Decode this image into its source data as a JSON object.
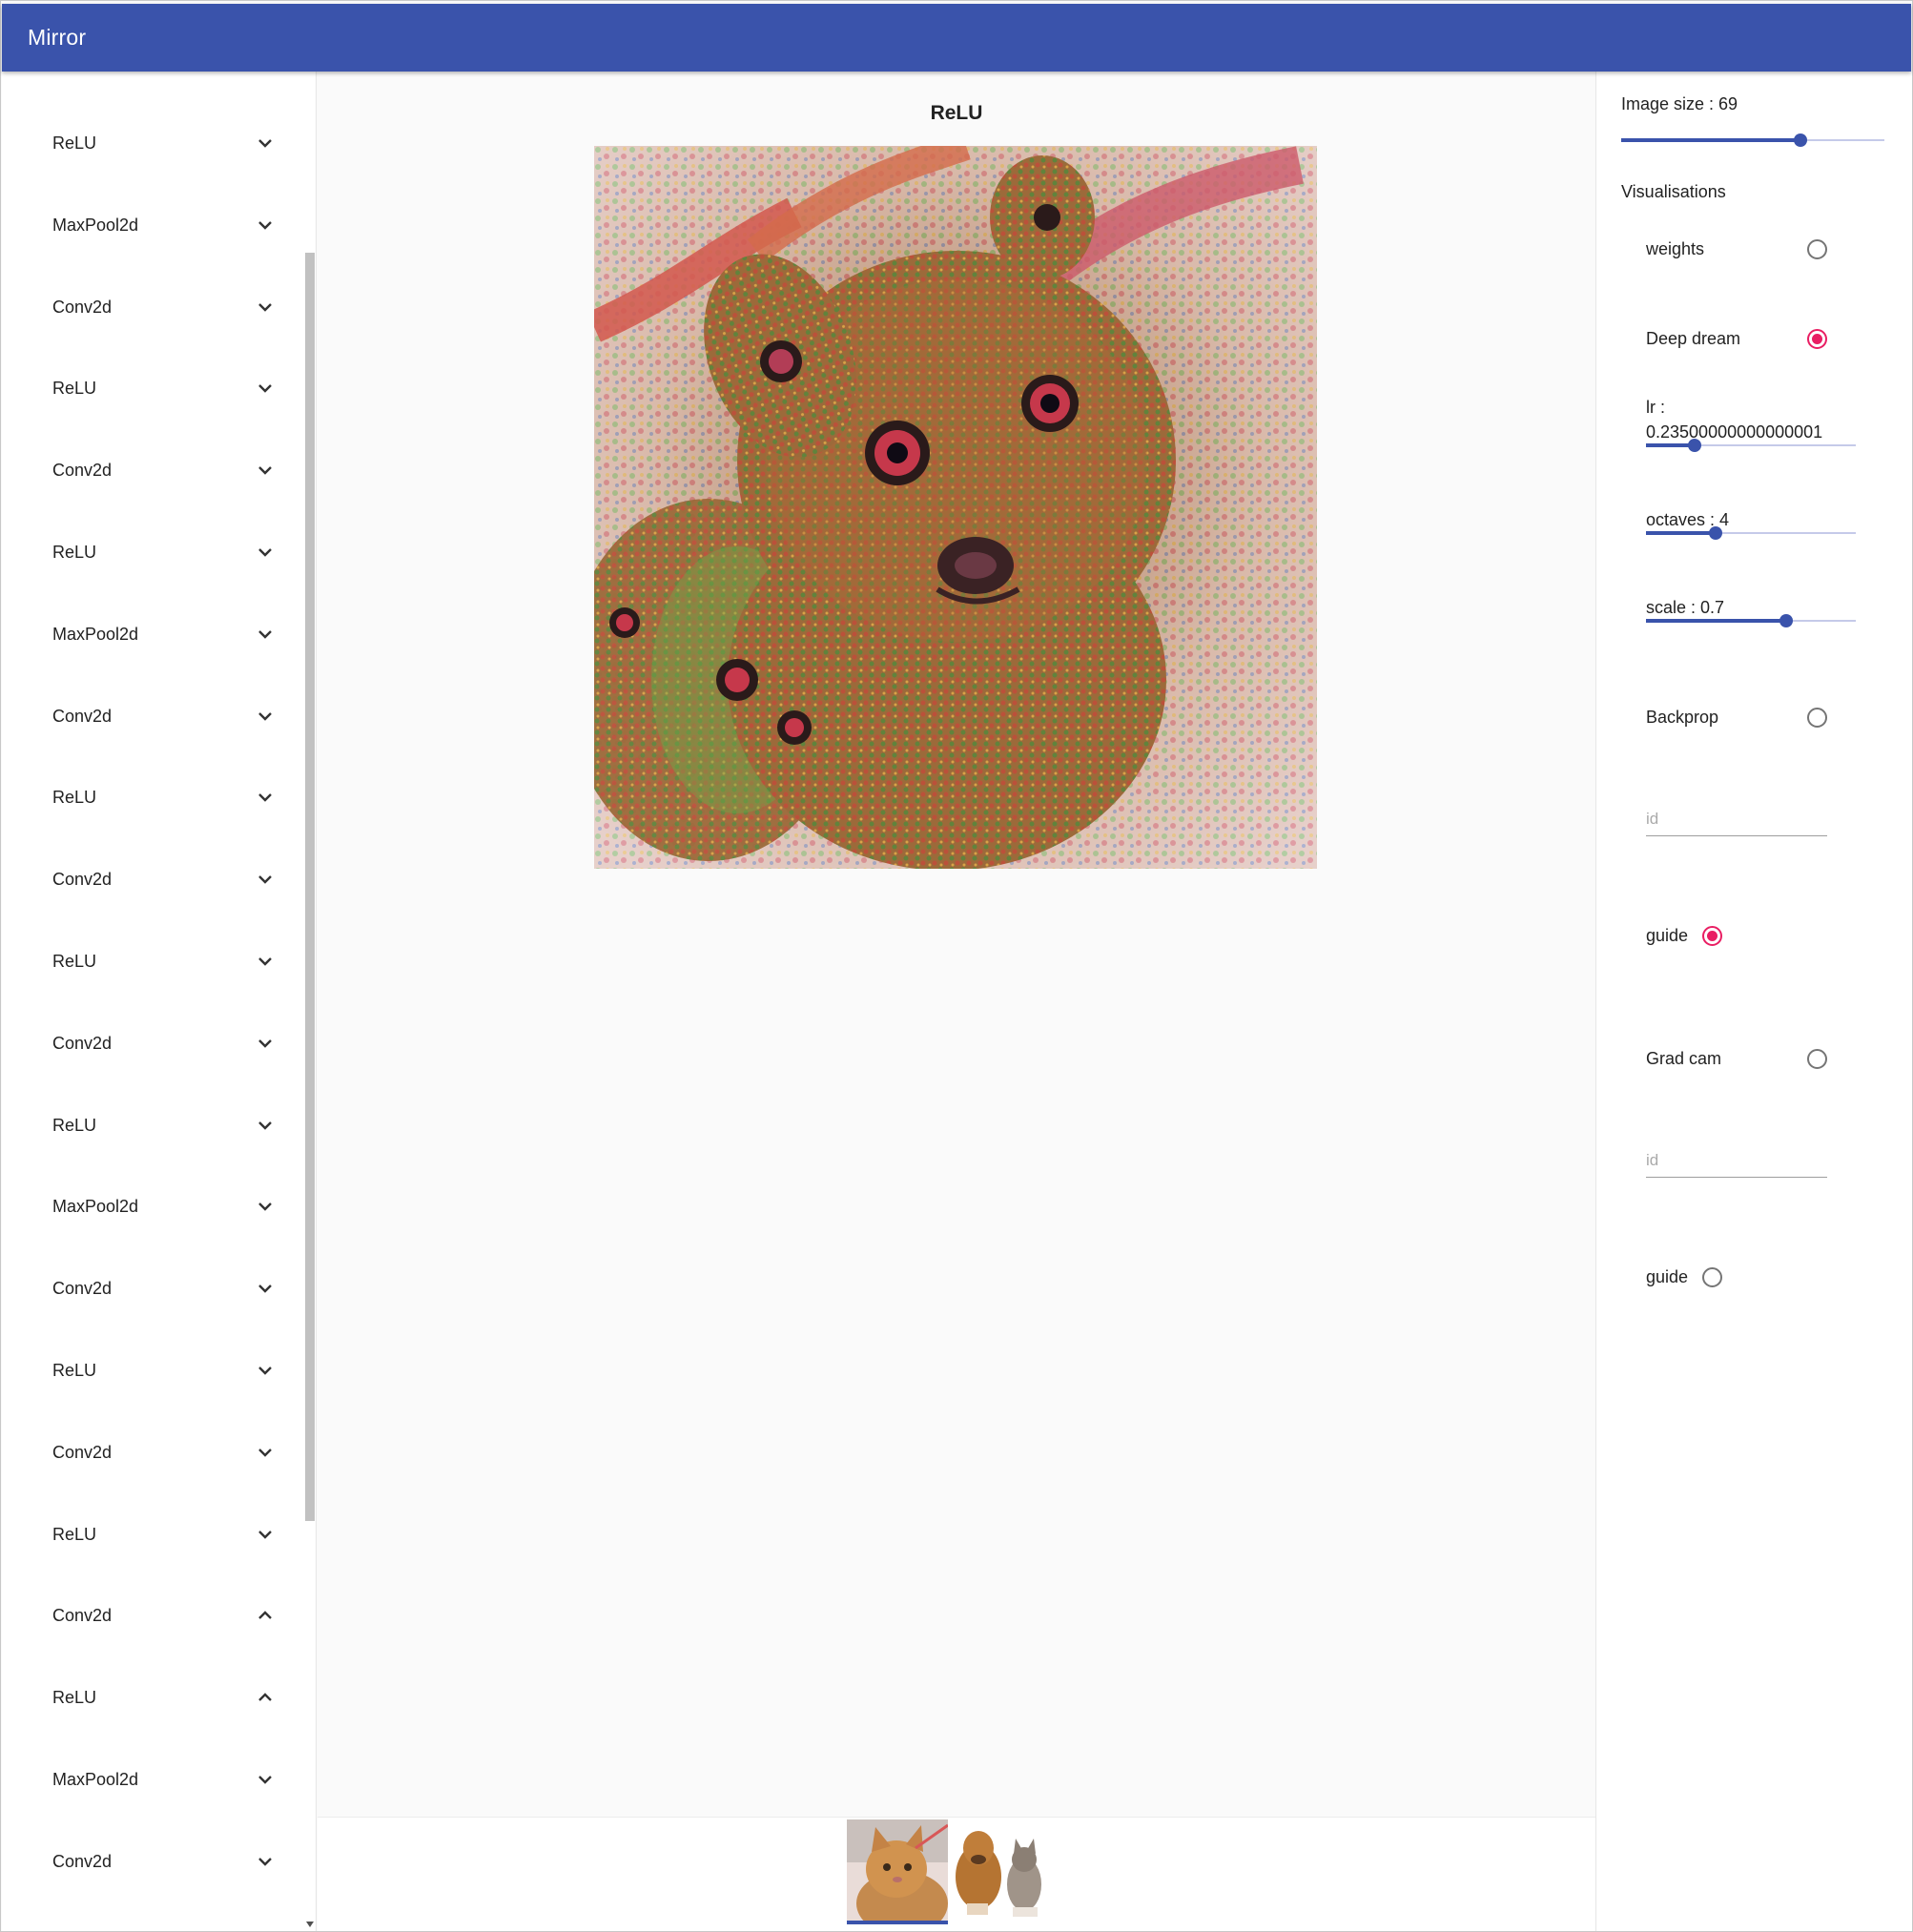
{
  "app": {
    "title": "Mirror"
  },
  "sidebar": {
    "layers": [
      {
        "label": "ReLU",
        "expanded": false
      },
      {
        "label": "MaxPool2d",
        "expanded": false
      },
      {
        "label": "Conv2d",
        "expanded": false
      },
      {
        "label": "ReLU",
        "expanded": false
      },
      {
        "label": "Conv2d",
        "expanded": false
      },
      {
        "label": "ReLU",
        "expanded": false
      },
      {
        "label": "MaxPool2d",
        "expanded": false
      },
      {
        "label": "Conv2d",
        "expanded": false
      },
      {
        "label": "ReLU",
        "expanded": false
      },
      {
        "label": "Conv2d",
        "expanded": false
      },
      {
        "label": "ReLU",
        "expanded": false
      },
      {
        "label": "Conv2d",
        "expanded": false
      },
      {
        "label": "ReLU",
        "expanded": false
      },
      {
        "label": "MaxPool2d",
        "expanded": false
      },
      {
        "label": "Conv2d",
        "expanded": false
      },
      {
        "label": "ReLU",
        "expanded": false
      },
      {
        "label": "Conv2d",
        "expanded": false
      },
      {
        "label": "ReLU",
        "expanded": false
      },
      {
        "label": "Conv2d",
        "expanded": true
      },
      {
        "label": "ReLU",
        "expanded": true
      },
      {
        "label": "MaxPool2d",
        "expanded": false
      },
      {
        "label": "Conv2d",
        "expanded": false
      }
    ]
  },
  "main": {
    "layer_title": "ReLU",
    "thumbnails": [
      {
        "icon": "cat-photo",
        "selected": true
      },
      {
        "icon": "dog-and-cat-photo",
        "selected": false
      }
    ]
  },
  "settings": {
    "image_size_label": "Image size : 69",
    "image_size_fraction": 0.68,
    "visualisations_label": "Visualisations",
    "weights": {
      "label": "weights",
      "selected": false
    },
    "deep_dream": {
      "label": "Deep dream",
      "selected": true,
      "lr_label": "lr :",
      "lr_value": "0.23500000000000001",
      "lr_fraction": 0.23,
      "octaves_label": "octaves : 4",
      "octaves_fraction": 0.33,
      "scale_label": "scale : 0.7",
      "scale_fraction": 0.67
    },
    "backprop": {
      "label": "Backprop",
      "selected": false,
      "id_placeholder": "id",
      "guide_label": "guide",
      "guide_selected": true
    },
    "grad_cam": {
      "label": "Grad cam",
      "selected": false,
      "id_placeholder": "id",
      "guide_label": "guide",
      "guide_selected": false
    }
  },
  "colors": {
    "primary": "#3a53ab",
    "accent": "#e91e63"
  }
}
